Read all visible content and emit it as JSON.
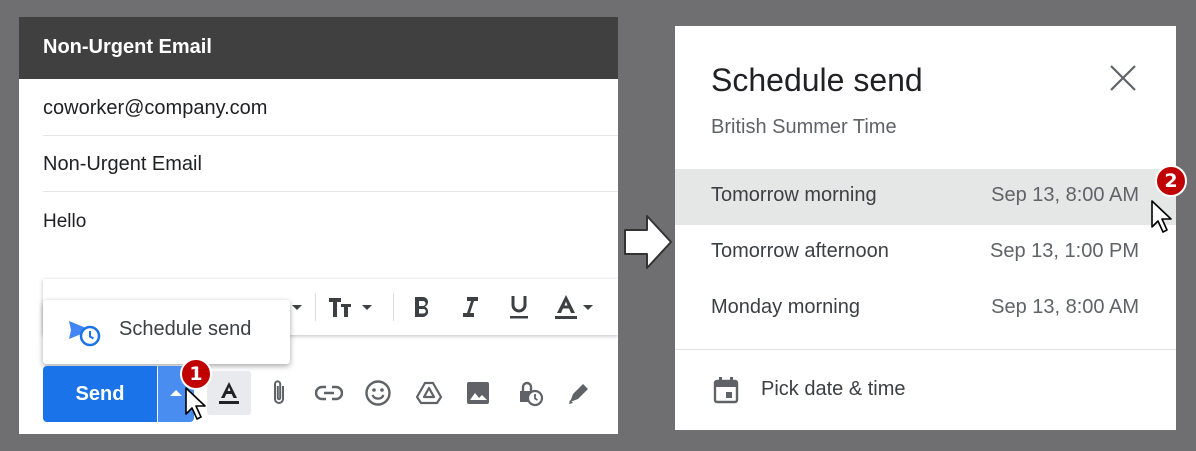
{
  "compose": {
    "title": "Non-Urgent Email",
    "to": "coworker@company.com",
    "subject": "Non-Urgent Email",
    "body": "Hello",
    "send_label": "Send",
    "schedule_menu_label": "Schedule send"
  },
  "schedule_dialog": {
    "title": "Schedule send",
    "timezone": "British Summer Time",
    "options": [
      {
        "label": "Tomorrow morning",
        "time": "Sep 13, 8:00 AM"
      },
      {
        "label": "Tomorrow afternoon",
        "time": "Sep 13, 1:00 PM"
      },
      {
        "label": "Monday morning",
        "time": "Sep 13, 8:00 AM"
      }
    ],
    "pick_label": "Pick date & time"
  },
  "steps": {
    "one": "1",
    "two": "2"
  },
  "colors": {
    "accent": "#1a73e8",
    "badge": "#c00000",
    "header": "#404040",
    "background": "#6f6f71"
  }
}
